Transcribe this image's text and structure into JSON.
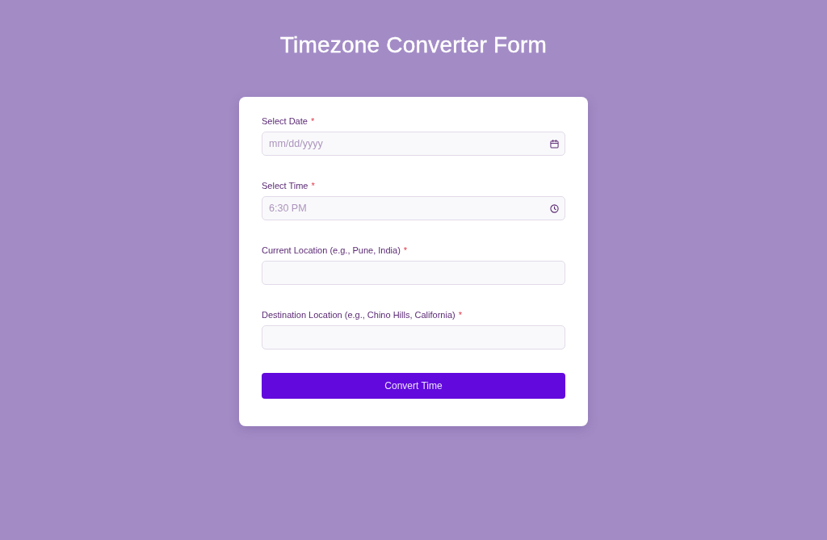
{
  "title": "Timezone Converter Form",
  "form": {
    "fields": [
      {
        "kind": "date",
        "label": "Select Date",
        "required_mark": "*",
        "placeholder": "mm/dd/yyyy"
      },
      {
        "kind": "time",
        "label": "Select Time",
        "required_mark": "*",
        "placeholder": "6:30 PM"
      },
      {
        "kind": "text",
        "label": "Current Location (e.g., Pune, India)",
        "required_mark": "*"
      },
      {
        "kind": "text",
        "label": "Destination Location (e.g., Chino Hills, California)",
        "required_mark": "*"
      }
    ],
    "submit_button": "Convert Time"
  }
}
